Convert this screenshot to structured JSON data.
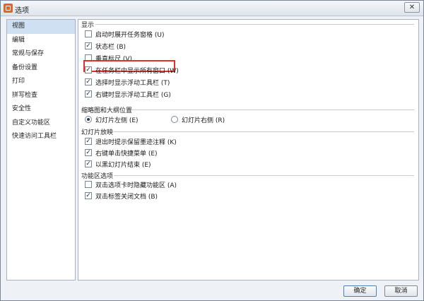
{
  "window": {
    "title": "选项",
    "close_label": "✕"
  },
  "sidebar": {
    "items": [
      {
        "label": "视图",
        "selected": true
      },
      {
        "label": "编辑"
      },
      {
        "label": "常规与保存"
      },
      {
        "label": "备份设置"
      },
      {
        "label": "打印"
      },
      {
        "label": "拼写检查"
      },
      {
        "label": "安全性"
      },
      {
        "label": "自定义功能区"
      },
      {
        "label": "快速访问工具栏"
      }
    ]
  },
  "display": {
    "title": "显示",
    "options": [
      {
        "label": "启动时展开任务窗格 (U)",
        "checked": false
      },
      {
        "label": "状态栏 (B)",
        "checked": true
      },
      {
        "label": "垂直标尺 (V)",
        "checked": false
      },
      {
        "label": "在任务栏中显示所有窗口 (W)",
        "checked": true
      },
      {
        "label": "选择时显示浮动工具栏 (T)",
        "checked": true
      },
      {
        "label": "右键时显示浮动工具栏 (G)",
        "checked": true
      }
    ]
  },
  "thumbnail": {
    "title": "缩略图和大纲位置",
    "left_label": "幻灯片左侧 (E)",
    "right_label": "幻灯片右侧 (R)",
    "selected": "left"
  },
  "slideshow": {
    "title": "幻灯片放映",
    "options": [
      {
        "label": "退出时提示保留墨迹注释 (K)",
        "checked": true
      },
      {
        "label": "右键单击快捷菜单 (E)",
        "checked": true
      },
      {
        "label": "以黑幻灯片结束 (E)",
        "checked": true
      }
    ]
  },
  "ribbon": {
    "title": "功能区选项",
    "options": [
      {
        "label": "双击选项卡时隐藏功能区 (A)",
        "checked": false
      },
      {
        "label": "双击标签关闭文档 (B)",
        "checked": true
      }
    ]
  },
  "buttons": {
    "ok": "确定",
    "cancel": "取消"
  },
  "colors": {
    "highlight": "#e0312d",
    "selected_bg": "#cfe0f3",
    "brand": "#e8632b"
  }
}
